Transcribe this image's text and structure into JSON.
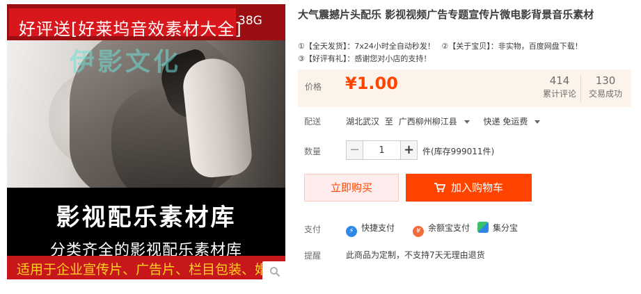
{
  "gallery": {
    "banner_text": "好评送[好莱坞音效素材大全]",
    "banner_size": "38G",
    "watermark": "伊影文化",
    "headline": "影视配乐素材库",
    "subheadline": "分类齐全的影视配乐素材库",
    "strip_text": "适用于企业宣传片、广告片、栏目包装、婚礼婚庆",
    "zoom_icon": "magnifier-icon"
  },
  "product": {
    "title": "大气震撼片头配乐 影视视频广告专题宣传片微电影背景音乐素材",
    "features": [
      "①【全天发货】：7x24小时全自动秒发！",
      "②【关于宝贝】：非实物，百度网盘下载！",
      "③【好评有礼】：感谢您对小店的支持！"
    ]
  },
  "price": {
    "label": "价格",
    "value": "¥1.00",
    "reviews_count": "414",
    "reviews_label": "累计评论",
    "sales_count": "130",
    "sales_label": "交易成功"
  },
  "shipping": {
    "label": "配送",
    "from": "湖北武汉",
    "to_word": "至",
    "destination": "广西柳州柳江县",
    "method": "快递 免运费"
  },
  "quantity": {
    "label": "数量",
    "minus": "−",
    "value": "1",
    "plus": "+",
    "unit_stock": "件(库存999011件)"
  },
  "actions": {
    "buy_now": "立即购买",
    "add_cart": "加入购物车"
  },
  "payment": {
    "label": "支付",
    "methods": [
      "快捷支付",
      "余额宝支付",
      "集分宝"
    ]
  },
  "reminder": {
    "label": "提醒",
    "text": "此商品为定制，不支持7天无理由退货"
  },
  "colors": {
    "accent": "#ff4400",
    "price_bg": "#fcf4ea",
    "banner_red": "#d7171b"
  }
}
